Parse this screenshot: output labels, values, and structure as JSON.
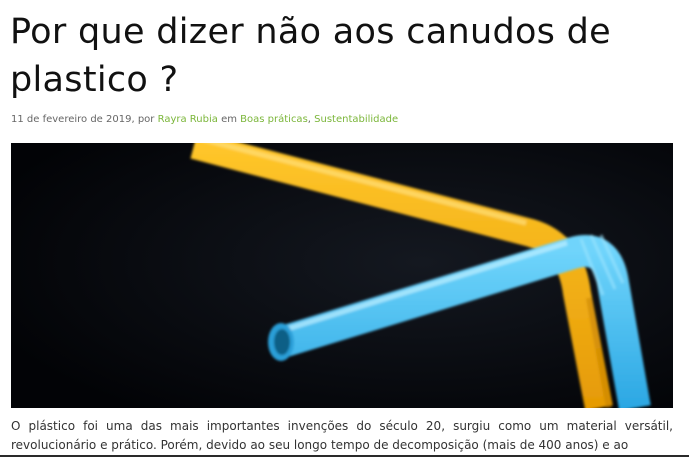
{
  "post": {
    "title": "Por que dizer não aos canudos de plastico ?",
    "meta": {
      "date": "11 de fevereiro de 2019",
      "by": ", por ",
      "author": "Rayra Rubia",
      "in": " em ",
      "category_1": "Boas práticas",
      "separator": ", ",
      "category_2": "Sustentabilidade"
    },
    "body_excerpt": "O plástico foi uma das mais importantes invenções do século 20, surgiu como um material versátil, revolucionário e prático. Porém, devido ao seu longo tempo de decomposição (mais de 400 anos) e ao"
  },
  "colors": {
    "link": "#7bb63a",
    "title": "#111111",
    "image_background": "#040508",
    "yellow_straw": "#f6b30f",
    "blue_straw": "#35b8ee"
  }
}
